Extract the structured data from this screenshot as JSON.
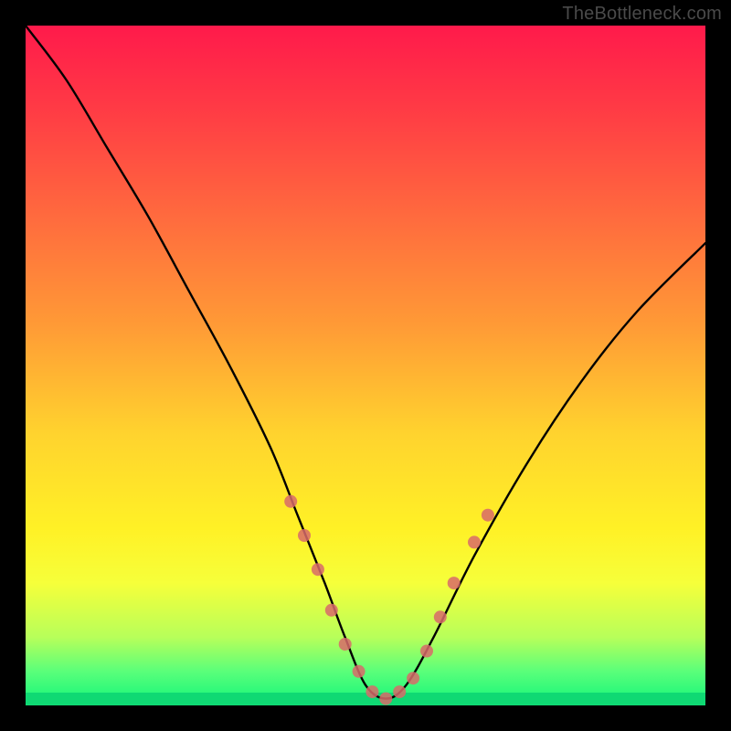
{
  "watermark": "TheBottleneck.com",
  "chart_data": {
    "type": "line",
    "title": "",
    "xlabel": "",
    "ylabel": "",
    "xlim": [
      0,
      100
    ],
    "ylim": [
      0,
      100
    ],
    "series": [
      {
        "name": "bottleneck-curve",
        "x": [
          0,
          6,
          12,
          18,
          24,
          30,
          36,
          40,
          44,
          47,
          50,
          53,
          56,
          60,
          66,
          74,
          82,
          90,
          100
        ],
        "y": [
          100,
          92,
          82,
          72,
          61,
          50,
          38,
          28,
          18,
          10,
          3,
          1,
          3,
          10,
          22,
          36,
          48,
          58,
          68
        ]
      }
    ],
    "markers": {
      "name": "highlight-dots",
      "x": [
        39,
        41,
        43,
        45,
        47,
        49,
        51,
        53,
        55,
        57,
        59,
        61,
        63,
        66,
        68
      ],
      "y": [
        30,
        25,
        20,
        14,
        9,
        5,
        2,
        1,
        2,
        4,
        8,
        13,
        18,
        24,
        28
      ]
    },
    "gradient_stops": [
      {
        "pos": 0.0,
        "color": "#ff1a4b"
      },
      {
        "pos": 0.28,
        "color": "#ff6a3e"
      },
      {
        "pos": 0.6,
        "color": "#ffd32e"
      },
      {
        "pos": 0.82,
        "color": "#f6ff3a"
      },
      {
        "pos": 1.0,
        "color": "#10f57a"
      }
    ]
  }
}
